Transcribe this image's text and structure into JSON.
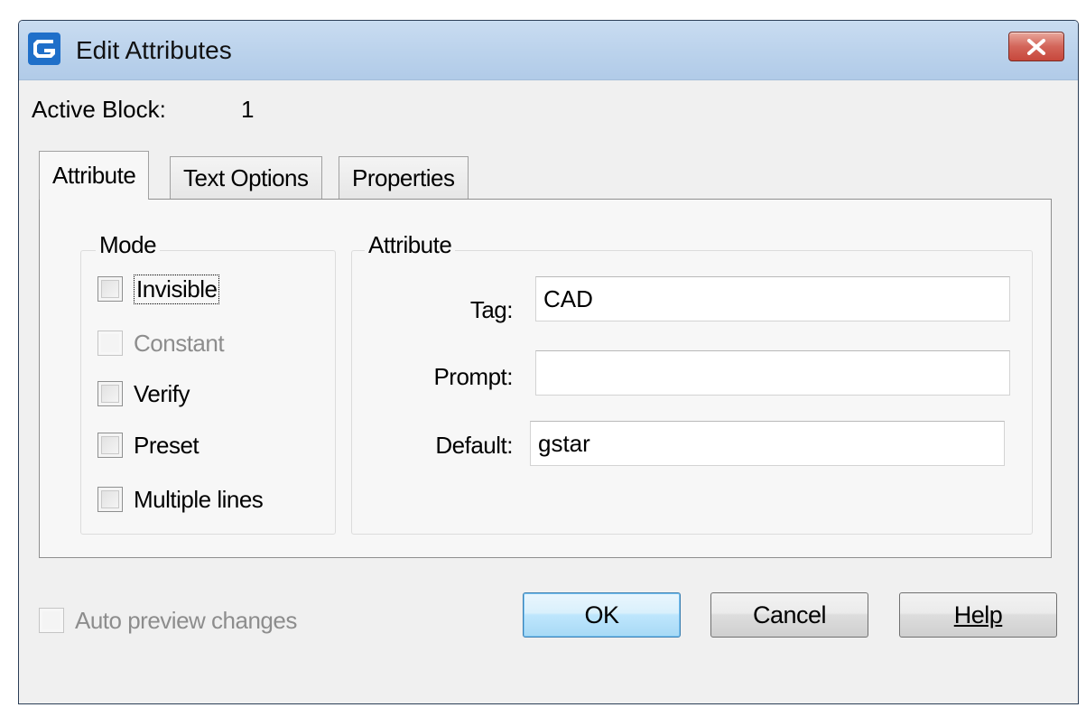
{
  "window": {
    "title": "Edit Attributes",
    "close_icon": "close-x-icon",
    "app_icon": "gstarcad-logo-icon"
  },
  "active_block": {
    "label": "Active Block:",
    "value": "1"
  },
  "tabs": [
    {
      "label": "Attribute",
      "selected": true
    },
    {
      "label": "Text Options",
      "selected": false
    },
    {
      "label": "Properties",
      "selected": false
    }
  ],
  "mode": {
    "title": "Mode",
    "options": [
      {
        "label": "Invisible",
        "checked": false,
        "enabled": true,
        "focused": true
      },
      {
        "label": "Constant",
        "checked": false,
        "enabled": false
      },
      {
        "label": "Verify",
        "checked": false,
        "enabled": true
      },
      {
        "label": "Preset",
        "checked": false,
        "enabled": true
      },
      {
        "label": "Multiple lines",
        "checked": false,
        "enabled": true
      }
    ]
  },
  "attribute": {
    "title": "Attribute",
    "tag_label": "Tag:",
    "tag_value": "CAD",
    "prompt_label": "Prompt:",
    "prompt_value": "",
    "default_label": "Default:",
    "default_value": "gstar"
  },
  "footer": {
    "auto_preview_label": "Auto preview changes",
    "auto_preview_checked": false,
    "auto_preview_enabled": false,
    "ok_label": "OK",
    "cancel_label": "Cancel",
    "help_label": "Help"
  },
  "colors": {
    "titlebar": "#bcd3ec",
    "close_button": "#c7483c",
    "default_button_border": "#3c7fb1",
    "disabled_text": "#8d8d8d"
  }
}
